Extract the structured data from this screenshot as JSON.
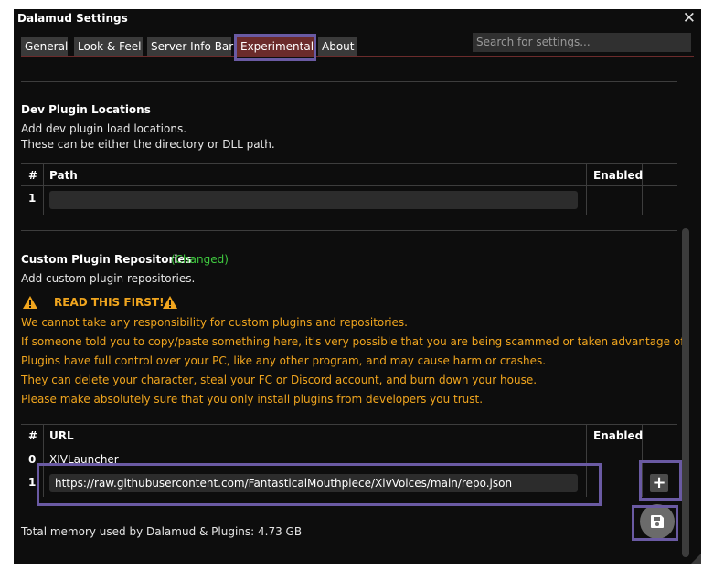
{
  "window": {
    "title": "Dalamud Settings"
  },
  "tabs": [
    {
      "label": "General"
    },
    {
      "label": "Look & Feel"
    },
    {
      "label": "Server Info Bar"
    },
    {
      "label": "Experimental"
    },
    {
      "label": "About"
    }
  ],
  "active_tab": "Experimental",
  "search": {
    "placeholder": "Search for settings..."
  },
  "dev_plugin": {
    "title": "Dev Plugin Locations",
    "desc1": "Add dev plugin load locations.",
    "desc2": "These can be either the directory or DLL path.",
    "columns": [
      "#",
      "Path",
      "Enabled"
    ],
    "rows": [
      {
        "num": "1",
        "path": ""
      }
    ]
  },
  "custom_repos": {
    "title": "Custom Plugin Repositories",
    "changed_label": "(Changed)",
    "desc": "Add custom plugin repositories.",
    "warning_title": "READ THIS FIRST!",
    "warnings": [
      "We cannot take any responsibility for custom plugins and repositories.",
      "If someone told you to copy/paste something here, it's very possible that you are being scammed or taken advantage of.",
      "Plugins have full control over your PC, like any other program, and may cause harm or crashes.",
      "They can delete your character, steal your FC or Discord account, and burn down your house.",
      "Please make absolutely sure that you only install plugins from developers you trust."
    ],
    "columns": [
      "#",
      "URL",
      "Enabled"
    ],
    "rows": [
      {
        "num": "0",
        "url": "XIVLauncher"
      },
      {
        "num": "1",
        "url": "https://raw.githubusercontent.com/FantasticalMouthpiece/XivVoices/main/repo.json"
      }
    ],
    "add_icon": "plus-icon"
  },
  "footer": {
    "memory_text": "Total memory used by Dalamud & Plugins: 4.73 GB"
  },
  "save_icon": "save-icon",
  "colors": {
    "accent": "#6b2b2b",
    "warning": "#f0a51e",
    "changed": "#3fca3f",
    "highlight": "#6a5aa3"
  }
}
